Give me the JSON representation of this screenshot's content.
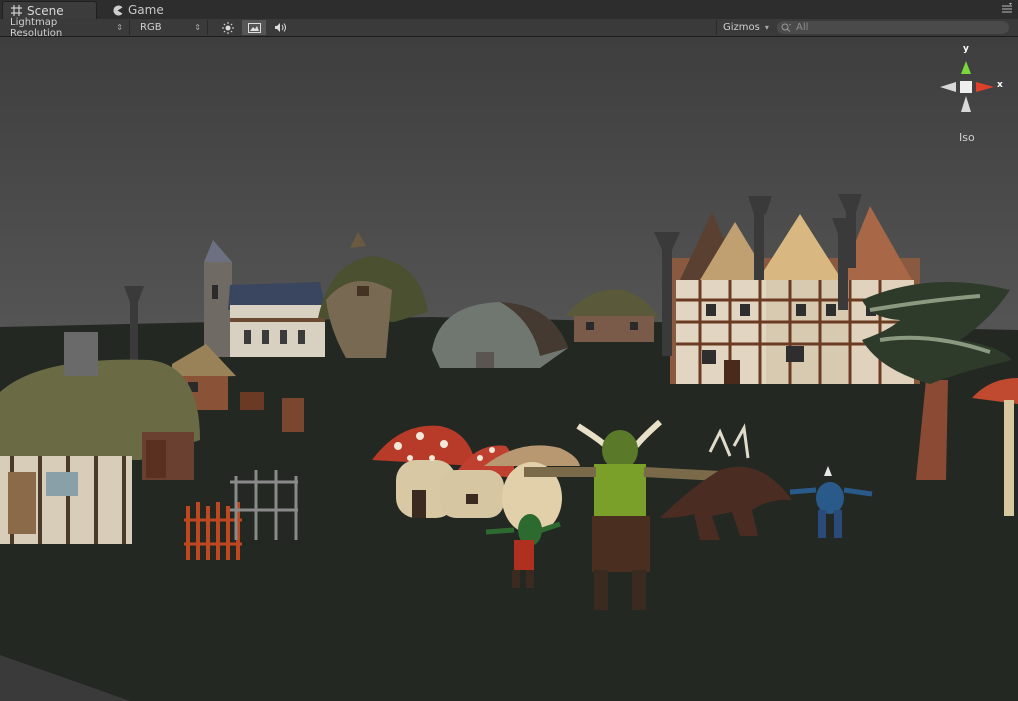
{
  "tabs": [
    {
      "label": "Scene",
      "icon": "grid-icon"
    },
    {
      "label": "Game",
      "icon": "pacman-icon"
    }
  ],
  "toolbar": {
    "render_mode": "Lightmap Resolution",
    "color_mode": "RGB",
    "gizmos_label": "Gizmos",
    "search_placeholder": "All"
  },
  "gizmo": {
    "y_label": "y",
    "x_label": "x",
    "projection": "Iso"
  },
  "colors": {
    "sky": "#4a4a4a",
    "ground": "#232823",
    "panel": "#3a3a3a",
    "axis_x": "#e0402a",
    "axis_y": "#7ad83a"
  }
}
